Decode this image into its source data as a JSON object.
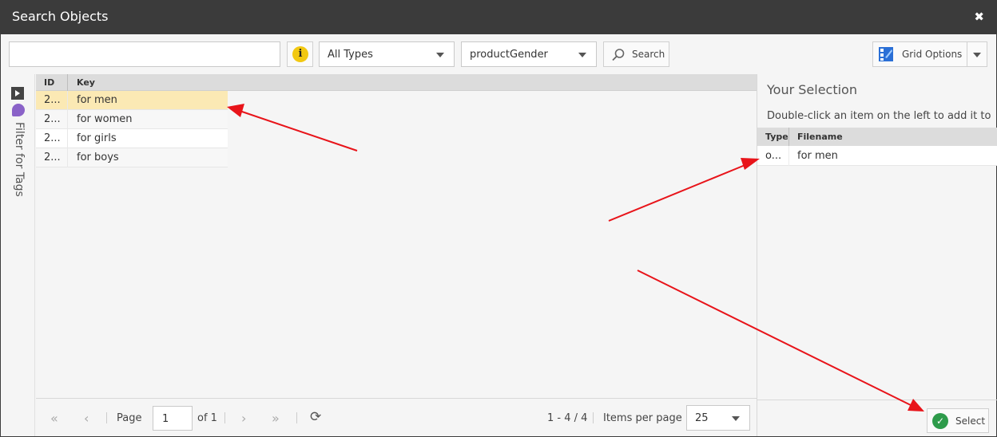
{
  "window": {
    "title": "Search Objects",
    "close_icon": "✖"
  },
  "toolbar": {
    "search_value": "",
    "info_icon": "i",
    "type_select": "All Types",
    "class_select": "productGender",
    "search_label": "Search",
    "grid_options_label": "Grid Options"
  },
  "sidebar": {
    "label": "Filter for Tags"
  },
  "grid": {
    "columns": [
      "ID",
      "Key"
    ],
    "rows": [
      {
        "id": "2...",
        "key": "for men"
      },
      {
        "id": "2...",
        "key": "for women"
      },
      {
        "id": "2...",
        "key": "for girls"
      },
      {
        "id": "2...",
        "key": "for boys"
      }
    ]
  },
  "pager": {
    "page_label": "Page",
    "page_value": "1",
    "of_label": "of 1",
    "range": "1 - 4 / 4",
    "ipp_label": "Items per page",
    "ipp_value": "25"
  },
  "selection": {
    "title": "Your Selection",
    "hint": "Double-click an item on the left to add it to",
    "columns": [
      "Type",
      "Filename"
    ],
    "rows": [
      {
        "type": "o...",
        "filename": "for men"
      }
    ],
    "select_label": "Select"
  },
  "colors": {
    "arrow": "#e8141a",
    "selected_row": "#fbe9b4",
    "title_bar": "#3b3b3b"
  }
}
